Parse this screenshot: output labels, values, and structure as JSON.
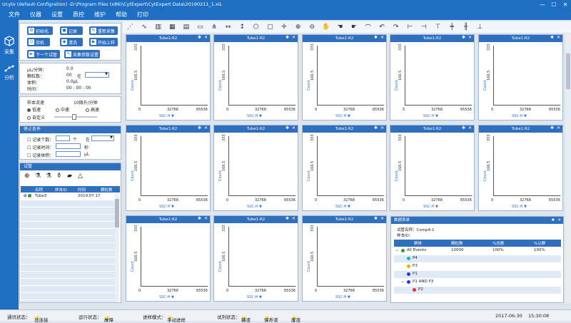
{
  "window": {
    "title": "Ucyto  (default-Configration)  -D:\\Program Files (x86)\\CytExpert\\CytExpert Data\\20190211_1.xiL"
  },
  "menu": [
    "文件",
    "仪器",
    "设置",
    "质控",
    "维护",
    "帮助",
    "打印"
  ],
  "nav": [
    {
      "label": "采集",
      "icon": "cube-icon"
    },
    {
      "label": "分析",
      "icon": "scatter-icon"
    }
  ],
  "acq_buttons": {
    "init": "初始化",
    "record": "记录",
    "restart": "重新采集",
    "standby": "待机",
    "clean": "清洗",
    "start_load": "开始上样",
    "next_tube": "下一个试管",
    "params": "采集参数设置"
  },
  "stats": {
    "rate_label": "μL/分钟：",
    "rate_value": "0.0",
    "count_label": "颗粒数：",
    "count_value": "00",
    "in_label": "在",
    "volume_label": "体积：",
    "volume_value": "0.0μL",
    "time_label": "时间：",
    "time_value": "00 : 00 : 00"
  },
  "flow": {
    "label": "样本流速",
    "value": "10微升/分钟",
    "low": "低速",
    "mid": "中速",
    "high": "高速",
    "custom": "自定义"
  },
  "stop": {
    "title": "停止条件",
    "rec_count": "记录个数：",
    "unit_count": "个",
    "in": "在",
    "rec_time": "记录时间：",
    "unit_sec": "秒",
    "rec_vol": "记录体积：",
    "unit_ul": "μL"
  },
  "tubes": {
    "title": "试管",
    "headers": [
      "名称",
      "样本ID",
      "时间",
      "颗粒数"
    ],
    "rows": [
      {
        "name": "Tube3",
        "id": "",
        "time": "2019.07.17",
        "count": ""
      }
    ]
  },
  "plots": {
    "title": "Tube1:R2",
    "ylabel": "Count",
    "xlabel": "SSC-H",
    "yticks": [
      "333",
      "166.5",
      "0"
    ],
    "xticks": [
      "32768",
      "65536"
    ]
  },
  "datatable": {
    "title": "数据表单",
    "tube_name_label": "试管名称：",
    "tube_name": "Comp4-1",
    "sample_id_label": "样本ID：",
    "headers": [
      "群体",
      "颗粒数",
      "%总数",
      "%父群"
    ],
    "rows": [
      {
        "name": "All Events",
        "count": "10000",
        "total": "100%",
        "parent": "100%",
        "color": "#2ca02c"
      },
      {
        "name": "P4",
        "count": "",
        "total": "",
        "parent": "",
        "color": "#1fb3c7"
      },
      {
        "name": "P3",
        "count": "",
        "total": "",
        "parent": "",
        "color": "#e6b200"
      },
      {
        "name": "P1",
        "count": "",
        "total": "",
        "parent": "",
        "color": "#1f3bd6"
      },
      {
        "name": "P1 AND P3",
        "count": "",
        "total": "",
        "parent": "",
        "color": "#1f3bd6"
      },
      {
        "name": "P2",
        "count": "",
        "total": "",
        "parent": "",
        "color": "#e03030"
      }
    ]
  },
  "status": {
    "comm_label": "通讯状态：",
    "comm": "已连接",
    "run_label": "运行状态：",
    "run": "故障",
    "mode_label": "进样模式：",
    "mode": "手动进样",
    "reagent_label": "试剂状态：",
    "r1": "鞘液",
    "r2": "保养液",
    "r3": "废液",
    "date": "2017-06-30",
    "time": "15:30:08"
  }
}
